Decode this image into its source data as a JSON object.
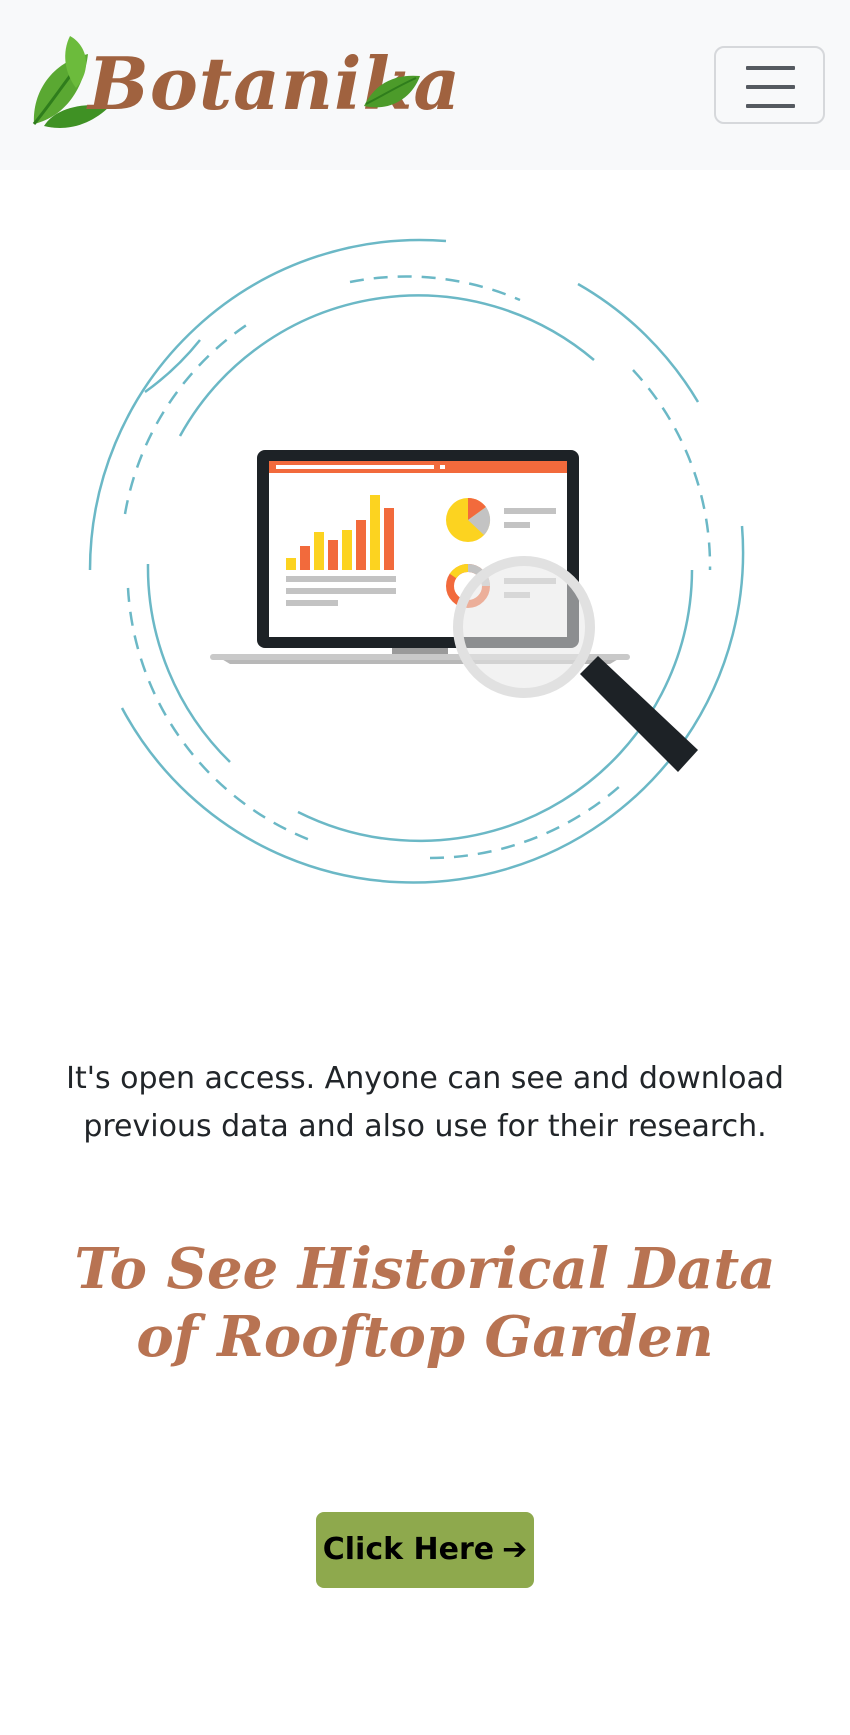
{
  "header": {
    "brand_name": "Botanika",
    "menu_icon": "hamburger-menu-icon"
  },
  "hero": {
    "illustration": "laptop-analytics-magnifier-illustration",
    "colors": {
      "ring": "#6bb8c6",
      "accent_orange": "#f26a3c",
      "accent_yellow": "#fcd320",
      "laptop_frame": "#1d2226"
    }
  },
  "content": {
    "description": "It's open access. Anyone can see and download previous data and also use for their research.",
    "headline": "To See Historical Data of Rooftop Garden"
  },
  "cta": {
    "label": "Click Here",
    "icon": "arrow-right-icon"
  },
  "colors": {
    "navbar_bg": "#f8f9fa",
    "brand": "#a0623f",
    "headline": "#b87352",
    "button_bg": "#8ea94d",
    "text": "#212529"
  }
}
